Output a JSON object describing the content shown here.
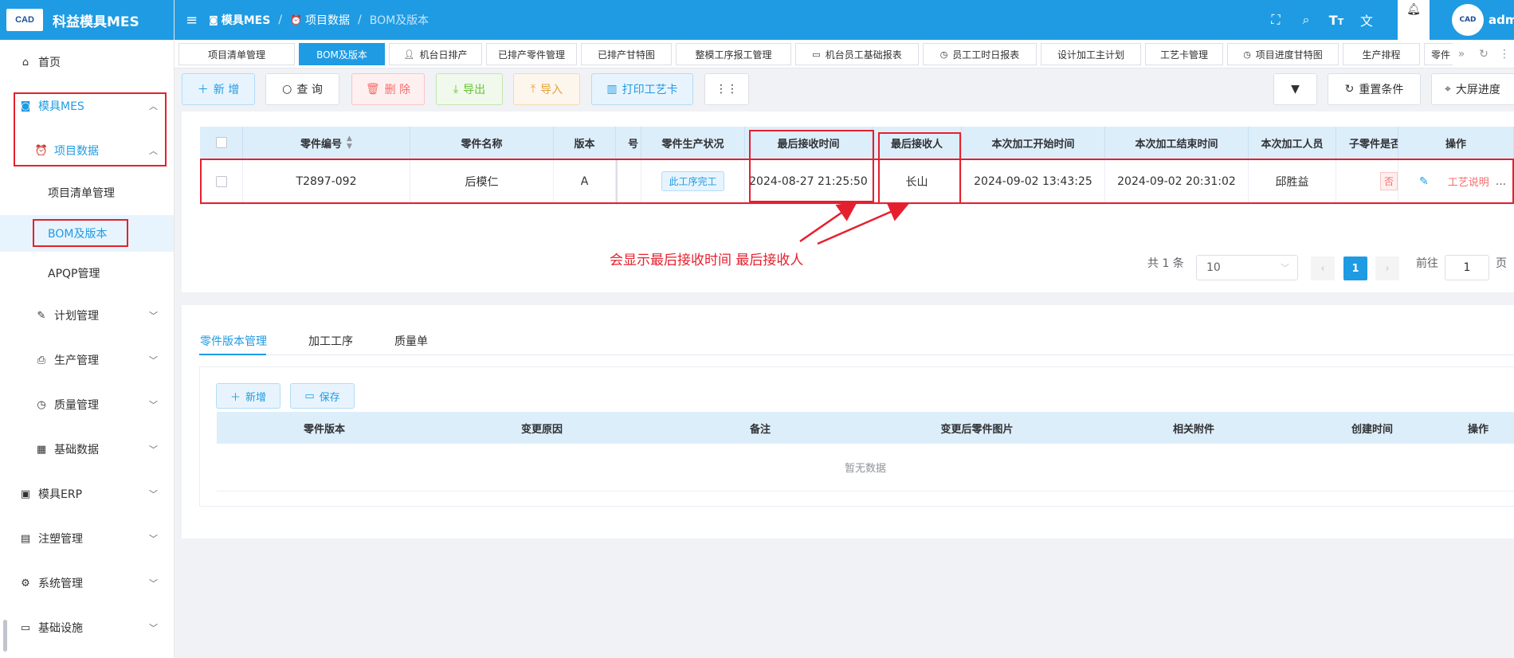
{
  "app": {
    "logo_label": "CAD",
    "title": "科益模具MES"
  },
  "sidebar": {
    "home": "首页",
    "mes": "模具MES",
    "project_data": "项目数据",
    "sub_items": [
      "项目清单管理",
      "BOM及版本",
      "APQP管理"
    ],
    "groups": [
      "计划管理",
      "生产管理",
      "质量管理",
      "基础数据"
    ],
    "top_groups": [
      "模具ERP",
      "注塑管理",
      "系统管理",
      "基础设施"
    ]
  },
  "header": {
    "breadcrumb": [
      "模具MES",
      "项目数据",
      "BOM及版本"
    ],
    "user": "admin"
  },
  "tags": [
    "项目清单管理",
    "BOM及版本",
    "机台日排产",
    "已排产零件管理",
    "已排产甘特图",
    "整模工序报工管理",
    "机台员工基础报表",
    "员工工时日报表",
    "设计加工主计划",
    "工艺卡管理",
    "项目进度甘特图",
    "生产排程",
    "零件"
  ],
  "toolbar": {
    "add": "新 增",
    "query": "查 询",
    "delete": "删 除",
    "export": "导出",
    "import": "导入",
    "print": "打印工艺卡",
    "reset": "重置条件",
    "bigscreen": "大屏进度"
  },
  "table": {
    "headers": [
      "零件编号",
      "零件名称",
      "版本",
      "号",
      "零件生产状况",
      "最后接收时间",
      "最后接收人",
      "本次加工开始时间",
      "本次加工结束时间",
      "本次加工人员",
      "子零件是否",
      "操作"
    ],
    "row": {
      "part_no": "T2897-092",
      "part_name": "后模仁",
      "version": "A",
      "status": "此工序完工",
      "last_receive_time": "2024-08-27 21:25:50",
      "last_receiver": "长山",
      "start_time": "2024-09-02 13:43:25",
      "end_time": "2024-09-02 20:31:02",
      "operator": "邱胜益",
      "child_flag": "否",
      "action": "工艺说明",
      "more": "..."
    }
  },
  "annotation": "会显示最后接收时间  最后接收人",
  "pagination": {
    "total": "共 1 条",
    "page_size": "10",
    "current": "1",
    "goto_label": "前往",
    "goto_value": "1",
    "page_suffix": "页"
  },
  "sub_tabs": [
    "零件版本管理",
    "加工工序",
    "质量单"
  ],
  "sub_toolbar": {
    "add": "新增",
    "save": "保存"
  },
  "sub_table": {
    "headers": [
      "零件版本",
      "变更原因",
      "备注",
      "变更后零件图片",
      "相关附件",
      "创建时间",
      "操作"
    ],
    "empty": "暂无数据"
  },
  "colors": {
    "primary": "#1e9be3",
    "annotation": "#e5202e",
    "danger": "#f56c6c",
    "success": "#67c23a",
    "warning": "#e6a23c"
  }
}
